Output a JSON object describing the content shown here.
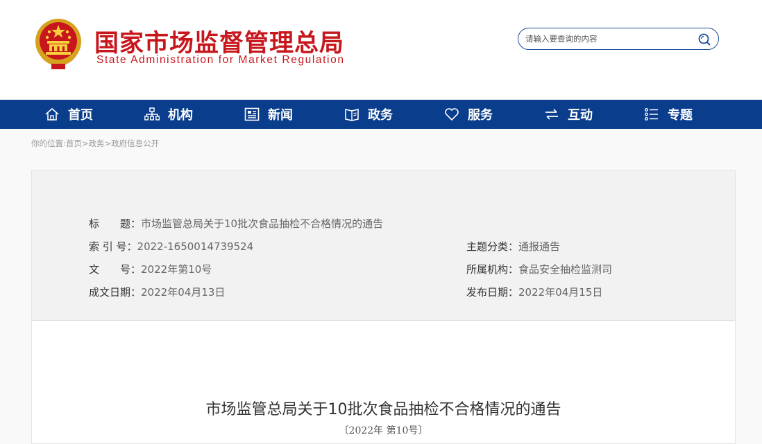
{
  "header": {
    "title": "国家市场监督管理总局",
    "subtitle": "State Administration for Market Regulation",
    "search_placeholder": "请输入要查询的内容",
    "brand_color": "#c8161d"
  },
  "nav": {
    "background": "#0a3d8c",
    "items": [
      {
        "label": "首页",
        "icon": "home-icon"
      },
      {
        "label": "机构",
        "icon": "org-chart-icon"
      },
      {
        "label": "新闻",
        "icon": "news-icon"
      },
      {
        "label": "政务",
        "icon": "book-icon"
      },
      {
        "label": "服务",
        "icon": "heart-icon"
      },
      {
        "label": "互动",
        "icon": "exchange-arrows-icon"
      },
      {
        "label": "专题",
        "icon": "list-icon"
      }
    ]
  },
  "breadcrumb": {
    "prefix": "你的位置:",
    "items": [
      "首页",
      "政务",
      "政府信息公开"
    ],
    "separator": ">"
  },
  "info": {
    "title_key": "标　　题：",
    "title_val": "市场监管总局关于10批次食品抽检不合格情况的通告",
    "index_key": "索 引 号：",
    "index_val": "2022-1650014739524",
    "category_key": "主题分类：",
    "category_val": "通报通告",
    "docno_key": "文　　号：",
    "docno_val": "2022年第10号",
    "org_key": "所属机构：",
    "org_val": "食品安全抽检监测司",
    "written_key": "成文日期：",
    "written_val": "2022年04月13日",
    "published_key": "发布日期：",
    "published_val": "2022年04月15日"
  },
  "document": {
    "title": "市场监管总局关于10批次食品抽检不合格情况的通告",
    "number": "〔2022年 第10号〕"
  }
}
